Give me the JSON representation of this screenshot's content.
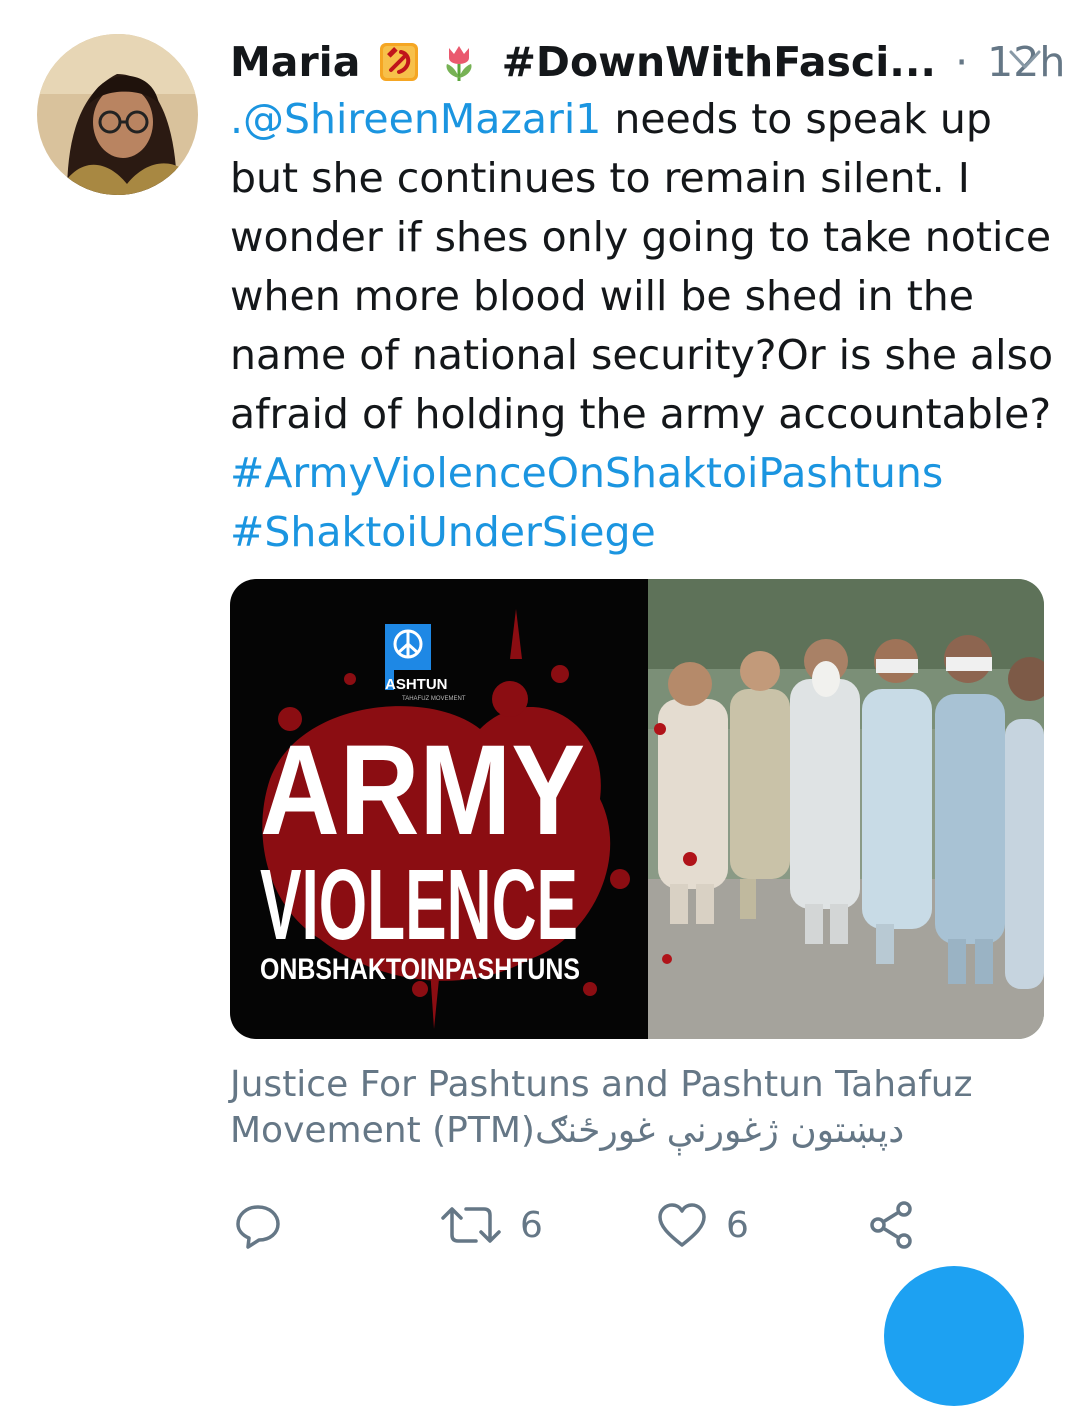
{
  "tweet": {
    "author": "Maria",
    "display_hashtag": "#DownWithFasci...",
    "separator": "·",
    "time": "12h",
    "text_lines": [
      {
        "link": ".@ShireenMazari1",
        "rest": " needs to speak up"
      },
      {
        "link": "",
        "rest": "but she continues to remain silent. I"
      },
      {
        "link": "",
        "rest": "wonder if shes only going to take notice"
      },
      {
        "link": "",
        "rest": "when more blood will be shed in the"
      },
      {
        "link": "",
        "rest": "name of national security?Or is she also"
      },
      {
        "link": "",
        "rest": "afraid of holding the army accountable?"
      },
      {
        "link": "#ArmyViolenceOnShaktoiPashtuns",
        "rest": ""
      },
      {
        "link": "#ShaktoiUnderSiege",
        "rest": ""
      }
    ],
    "media": {
      "poster_logo_text": "ASHTUN",
      "poster_logo_sub": "TAHAFUZ MOVEMENT",
      "poster_line1": "ARMY",
      "poster_line2": "VIOLENCE",
      "poster_line3": "ONBSHAKTOINPASHTUNS"
    },
    "source_lines": [
      "Justice For Pashtuns and Pashtun Tahafuz",
      "Movement (PTM)دپښتون ژغورنې غورځنګ"
    ],
    "actions": {
      "reply_icon": "reply-icon",
      "retweet_icon": "retweet-icon",
      "retweet_count": "6",
      "like_icon": "heart-icon",
      "like_count": "6",
      "share_icon": "share-icon"
    }
  },
  "colors": {
    "link": "#1b95e0",
    "secondary_text": "#657786",
    "accent": "#1da1f2"
  }
}
